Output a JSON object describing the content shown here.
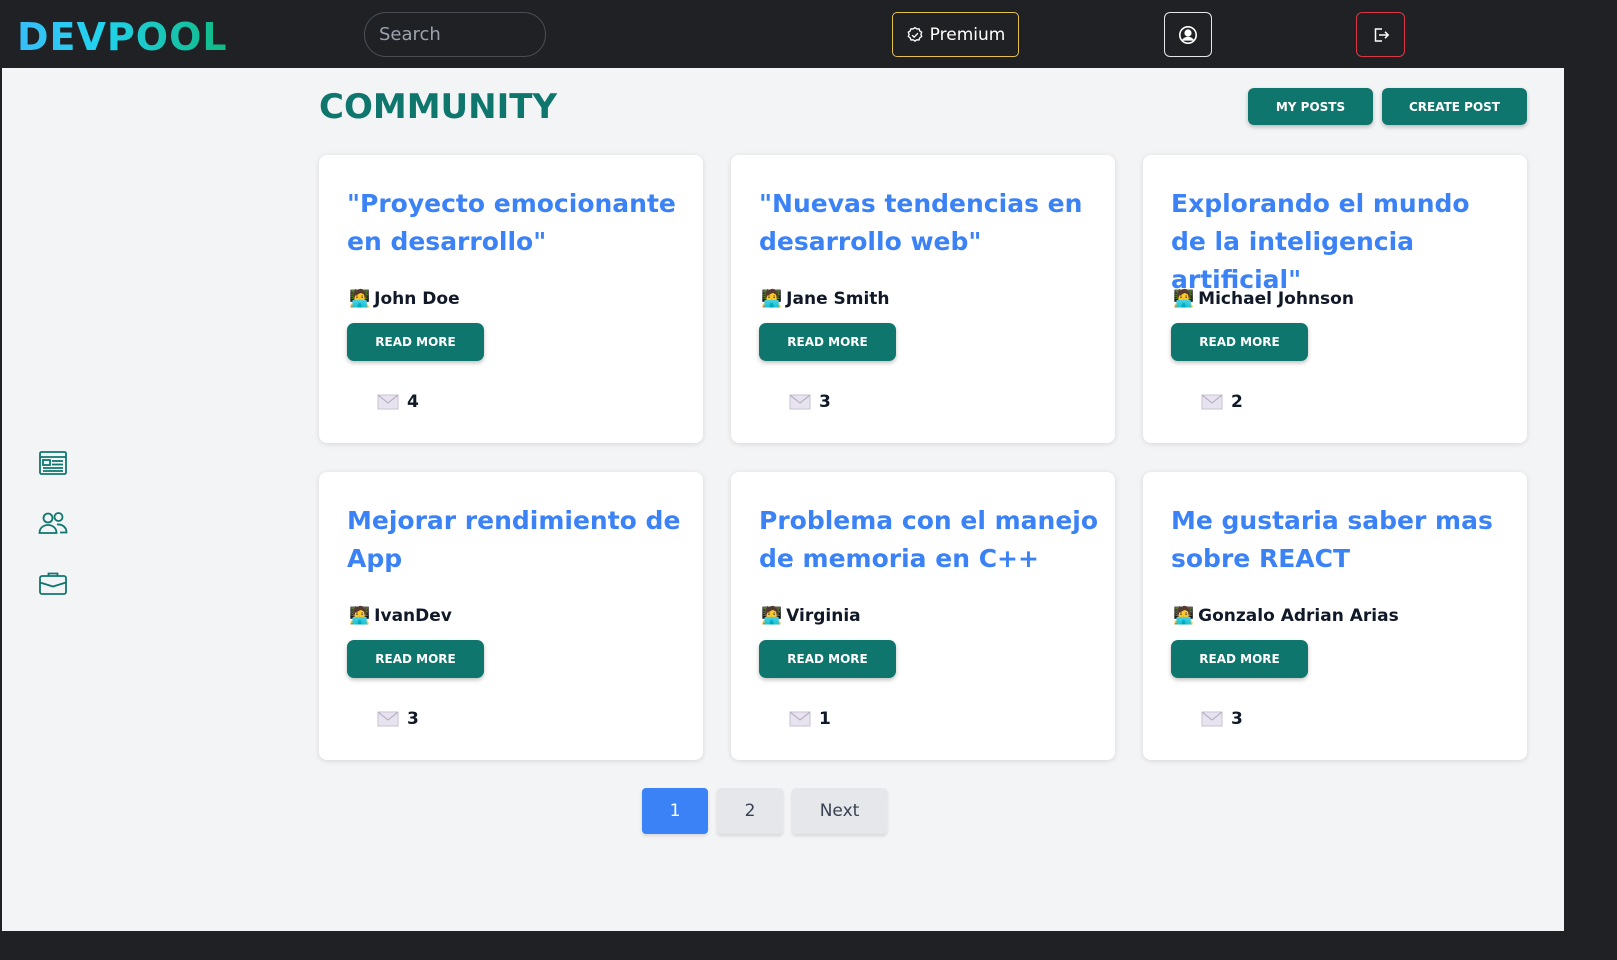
{
  "navbar": {
    "logo": "DEVPOOL",
    "search_placeholder": "Search",
    "premium_label": "Premium"
  },
  "sidebar": {
    "items": [
      {
        "icon": "newspaper-icon"
      },
      {
        "icon": "people-icon"
      },
      {
        "icon": "briefcase-icon"
      }
    ]
  },
  "main": {
    "title": "COMMUNITY",
    "my_posts_label": "MY POSTS",
    "create_post_label": "CREATE POST",
    "read_more_label": "READ MORE",
    "posts": [
      {
        "title": "\"Proyecto emocionante en desarrollo\"",
        "author": "John Doe",
        "comments": "4"
      },
      {
        "title": "\"Nuevas tendencias en desarrollo web\"",
        "author": "Jane Smith",
        "comments": "3"
      },
      {
        "title": "Explorando el mundo de la inteligencia artificial\"",
        "author": "Michael Johnson",
        "comments": "2"
      },
      {
        "title": "Mejorar rendimiento de App",
        "author": "IvanDev",
        "comments": "3"
      },
      {
        "title": "Problema con el manejo de memoria en C++",
        "author": "Virginia",
        "comments": "1"
      },
      {
        "title": "Me gustaria saber mas sobre REACT",
        "author": "Gonzalo Adrian Arias",
        "comments": "3"
      }
    ]
  },
  "pagination": {
    "pages": [
      "1",
      "2"
    ],
    "current": "1",
    "next_label": "Next"
  },
  "colors": {
    "accent": "#0f766e",
    "title_blue": "#3b82f6",
    "navbar_bg": "#1f2124"
  }
}
